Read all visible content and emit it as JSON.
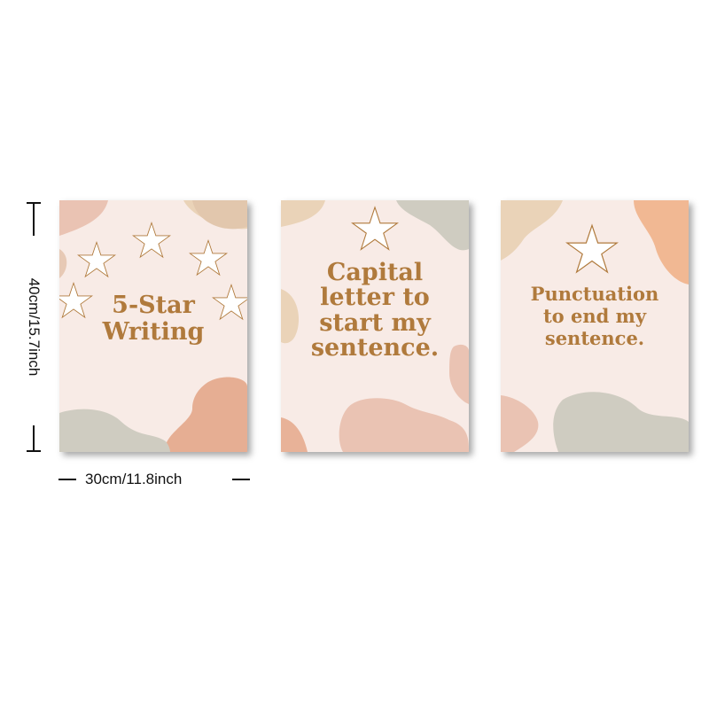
{
  "dimensions": {
    "height_label": "40cm/15.7inch",
    "width_label": "30cm/11.8inch"
  },
  "panels": [
    {
      "lines": [
        "5-Star",
        "Writing"
      ],
      "star_count": 5
    },
    {
      "lines": [
        "Capital",
        "letter to",
        "start my",
        "sentence."
      ],
      "star_count": 1
    },
    {
      "lines": [
        "Punctuation",
        "to end my",
        "sentence."
      ],
      "star_count": 1
    }
  ],
  "colors": {
    "text": "#b07a3c",
    "background": "#f8ebe6",
    "blob_tan": "#ead3b8",
    "blob_sage": "#cfccc1",
    "blob_peach": "#e8b298",
    "blob_pink": "#eac3b3"
  }
}
